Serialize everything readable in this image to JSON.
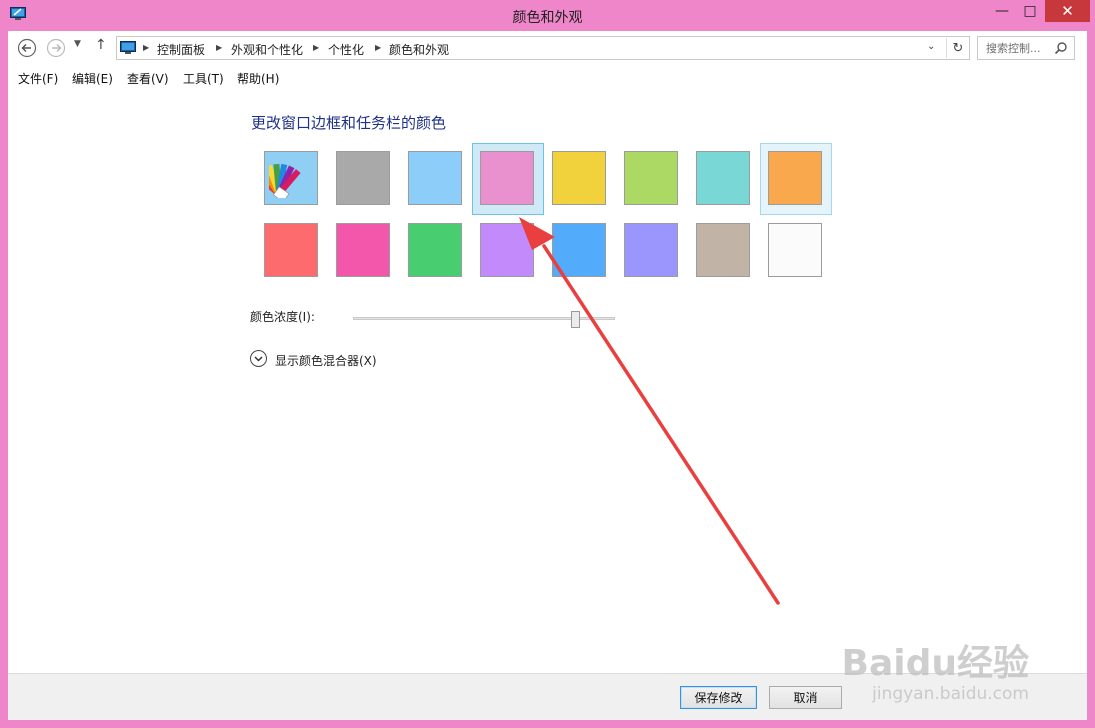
{
  "window": {
    "title": "颜色和外观",
    "controls": {
      "minimize": "—",
      "maximize": "□",
      "close": "✕"
    }
  },
  "address_bar": {
    "breadcrumbs": [
      "控制面板",
      "外观和个性化",
      "个性化",
      "颜色和外观"
    ],
    "search_placeholder": "搜索控制..."
  },
  "menu": [
    "文件(F)",
    "编辑(E)",
    "查看(V)",
    "工具(T)",
    "帮助(H)"
  ],
  "content": {
    "title": "更改窗口边框和任务栏的颜色",
    "swatches_row1": [
      {
        "name": "auto",
        "color": "#8fcff4",
        "icon": "color-palette-icon"
      },
      {
        "name": "gray",
        "color": "#a9a9a9"
      },
      {
        "name": "light-blue",
        "color": "#8ccdfa"
      },
      {
        "name": "pink",
        "color": "#e991cf",
        "selected": true
      },
      {
        "name": "yellow",
        "color": "#f2d23c"
      },
      {
        "name": "lime",
        "color": "#acd864"
      },
      {
        "name": "teal",
        "color": "#79d8d6"
      },
      {
        "name": "orange",
        "color": "#f9a84e",
        "hover": true
      }
    ],
    "swatches_row2": [
      {
        "name": "red",
        "color": "#fe6b6e"
      },
      {
        "name": "magenta",
        "color": "#f357ac"
      },
      {
        "name": "green",
        "color": "#48cd70"
      },
      {
        "name": "violet",
        "color": "#c28afa"
      },
      {
        "name": "blue",
        "color": "#52abfb"
      },
      {
        "name": "periwinkle",
        "color": "#9a96fd"
      },
      {
        "name": "taupe",
        "color": "#c2b3a7"
      },
      {
        "name": "white",
        "color": "#fbfbfb"
      }
    ],
    "intensity_label": "颜色浓度(I):",
    "intensity_value": 0.86,
    "mixer_label": "显示颜色混合器(X)"
  },
  "buttons": {
    "save": "保存修改",
    "cancel": "取消"
  },
  "watermark": {
    "logo": "Baidu经验",
    "url": "jingyan.baidu.com"
  }
}
